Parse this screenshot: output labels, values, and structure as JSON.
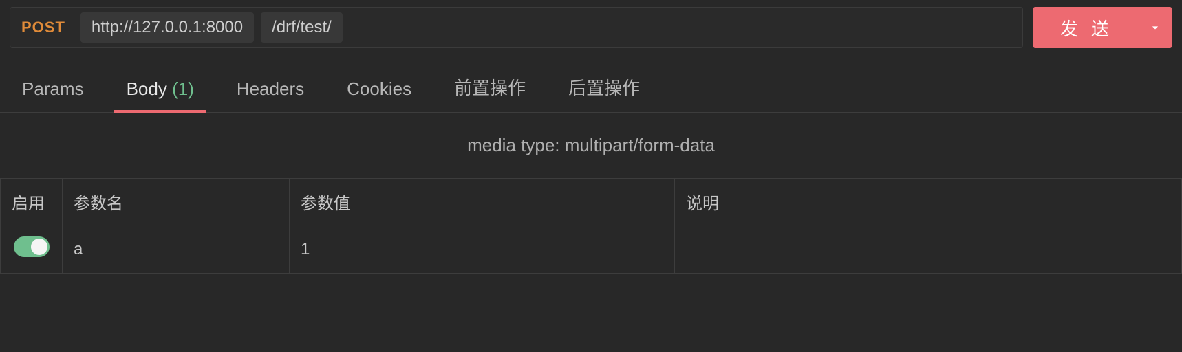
{
  "request": {
    "method": "POST",
    "base_url": "http://127.0.0.1:8000",
    "path": "/drf/test/",
    "send_label": "发 送"
  },
  "tabs": {
    "params": {
      "label": "Params"
    },
    "body": {
      "label": "Body",
      "count": "(1)"
    },
    "headers": {
      "label": "Headers"
    },
    "cookies": {
      "label": "Cookies"
    },
    "pre": {
      "label": "前置操作"
    },
    "post": {
      "label": "后置操作"
    }
  },
  "body_section": {
    "media_type_label": "media type: multipart/form-data",
    "columns": {
      "enable": "启用",
      "name": "参数名",
      "value": "参数值",
      "desc": "说明"
    },
    "rows": [
      {
        "enabled": true,
        "name": "a",
        "value": "1",
        "desc": ""
      }
    ]
  }
}
